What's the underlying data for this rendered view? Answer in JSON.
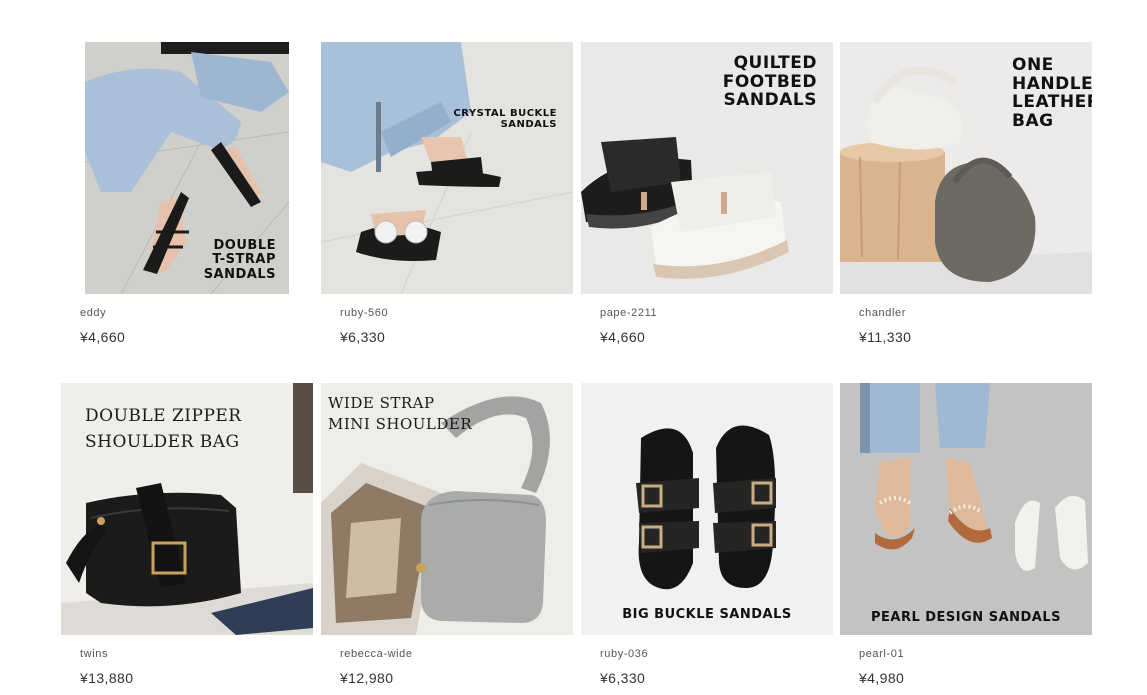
{
  "products": [
    {
      "name": "eddy",
      "price": "¥4,660",
      "caption": "DOUBLE\nT-STRAP\nSANDALS"
    },
    {
      "name": "ruby-560",
      "price": "¥6,330",
      "caption": "CRYSTAL BUCKLE\nSANDALS"
    },
    {
      "name": "pape-2211",
      "price": "¥4,660",
      "caption": "QUILTED\nFOOTBED\nSANDALS"
    },
    {
      "name": "chandler",
      "price": "¥11,330",
      "caption": "ONE\nHANDLE\nLEATHER\nBAG"
    },
    {
      "name": "twins",
      "price": "¥13,880",
      "caption": "DOUBLE ZIPPER\nSHOULDER BAG"
    },
    {
      "name": "rebecca-wide",
      "price": "¥12,980",
      "caption": "WIDE STRAP\nMINI SHOULDER"
    },
    {
      "name": "ruby-036",
      "price": "¥6,330",
      "caption": "BIG BUCKLE SANDALS"
    },
    {
      "name": "pearl-01",
      "price": "¥4,980",
      "caption": "PEARL DESIGN SANDALS"
    }
  ]
}
